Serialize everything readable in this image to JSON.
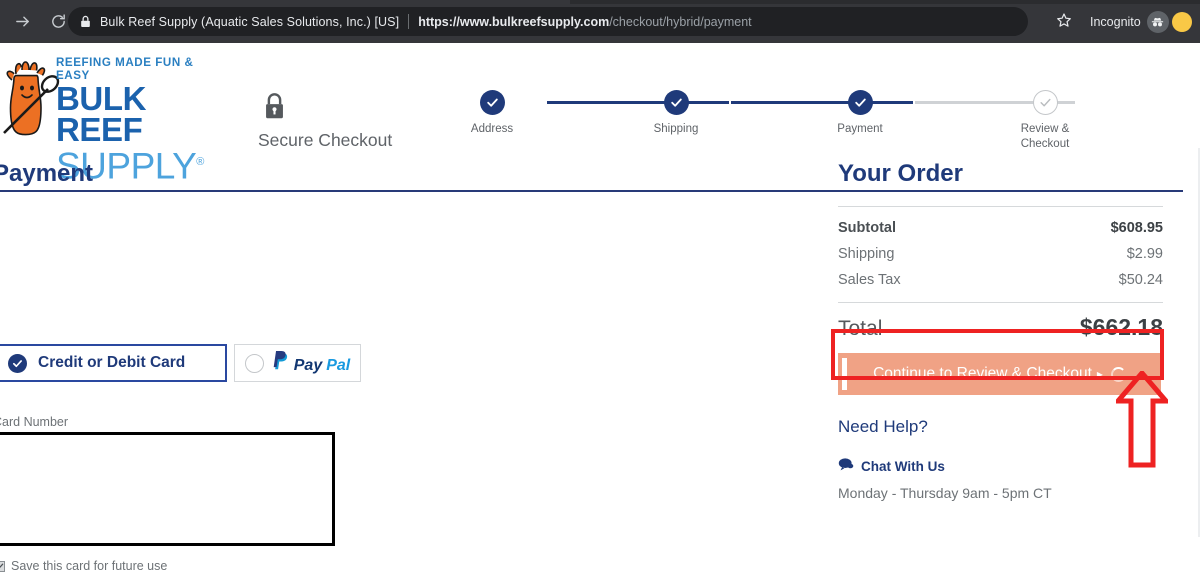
{
  "browser": {
    "back_icon": "arrow-forward-icon",
    "reload_icon": "reload-icon",
    "lock_icon": "lock-icon",
    "site_identity": "Bulk Reef Supply (Aquatic Sales Solutions, Inc.) [US]",
    "url_origin": "https://www.bulkreefsupply.com",
    "url_path": "/checkout/hybrid/payment",
    "bookmark_icon": "star-icon",
    "incognito_label": "Incognito",
    "incognito_icon": "incognito-icon",
    "profile_icon": "profile-avatar-icon"
  },
  "header": {
    "logo": {
      "tagline": "REEFING MADE FUN & EASY",
      "line1": "BULK REEF",
      "line2": "SUPPLY",
      "registered": "®",
      "mascot_icon": "coral-mascot-icon"
    },
    "secure": {
      "icon": "padlock-icon",
      "label": "Secure Checkout"
    },
    "steps": [
      {
        "label": "Address",
        "state": "complete",
        "icon": "check-circle-icon"
      },
      {
        "label": "Shipping",
        "state": "complete",
        "icon": "check-circle-icon"
      },
      {
        "label": "Payment",
        "state": "complete",
        "icon": "check-circle-icon"
      },
      {
        "label": "Review &\nCheckout",
        "label_line1": "Review &",
        "label_line2": "Checkout",
        "state": "upcoming",
        "icon": "check-circle-outline-icon"
      }
    ]
  },
  "payment": {
    "title": "Payment",
    "methods": [
      {
        "label": "Credit or Debit Card",
        "selected": true,
        "icon": "radio-selected-icon"
      },
      {
        "label": "PayPal",
        "selected": false,
        "icon": "radio-unselected-icon",
        "logo_part1": "Pay",
        "logo_part2": "Pal"
      }
    ],
    "card_number": {
      "label": "Card Number",
      "value": "",
      "placeholder": ""
    },
    "save_card": {
      "label": "Save this card for future use",
      "checked": true
    }
  },
  "order": {
    "title": "Your Order",
    "lines": [
      {
        "label": "Subtotal",
        "value": "$608.95",
        "emphasis": true
      },
      {
        "label": "Shipping",
        "value": "$2.99",
        "emphasis": false
      },
      {
        "label": "Sales Tax",
        "value": "$50.24",
        "emphasis": false
      }
    ],
    "total": {
      "label": "Total",
      "value": "$662.18"
    },
    "cta": {
      "label": "Continue to Review & Checkout",
      "caret": "▸",
      "state": "loading",
      "background": "#f0a285"
    },
    "need_help": "Need Help?",
    "chat": {
      "icon": "chat-bubble-icon",
      "label": "Chat With Us",
      "hours": "Monday - Thursday 9am - 5pm CT"
    }
  },
  "annotations": {
    "highlight_color": "#ee2222",
    "rect_target": "continue-to-review-and-checkout-button",
    "arrow_icon": "up-arrow-annotation-icon"
  }
}
